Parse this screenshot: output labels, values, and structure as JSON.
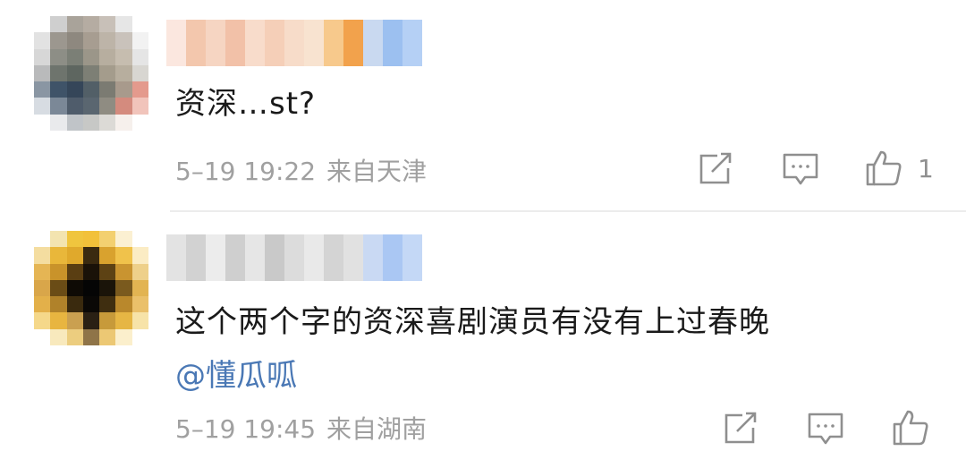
{
  "comments": [
    {
      "text": "资深…st?",
      "date": "5–19 19:22",
      "location": "来自天津",
      "like_count": "1"
    },
    {
      "text": "这个两个字的资深喜剧演员有没有上过春晚",
      "mention": "@懂瓜呱",
      "date": "5–19 19:45",
      "location": "来自湖南",
      "like_count": ""
    }
  ],
  "icons": {
    "share": "share-icon",
    "comment": "comment-icon",
    "like": "thumbs-up-icon"
  },
  "colors": {
    "text": "#1a1a1a",
    "meta": "#a0a0a0",
    "mention": "#4a78b5",
    "divider": "#ececec"
  },
  "avatars": [
    [
      "#ffffff",
      "#cfcfcf",
      "#a9a39a",
      "#b5aca2",
      "#c8c0b8",
      "#e6e6e6",
      "#ffffff",
      "#e2e2e2",
      "#9c978f",
      "#8e887f",
      "#a79d91",
      "#bdb4a8",
      "#c9c2bb",
      "#f2f2f2",
      "#d7d7d7",
      "#8d8e86",
      "#7b7f76",
      "#9b9689",
      "#b7ae9f",
      "#c6bdaf",
      "#e5e5e5",
      "#b9babb",
      "#6e746d",
      "#5e6660",
      "#7d7f75",
      "#a49c8c",
      "#b7ae9e",
      "#d8d6d1",
      "#8a96a3",
      "#3f5368",
      "#354659",
      "#525f67",
      "#7b7b72",
      "#a89a8c",
      "#e49a8d",
      "#d7dce2",
      "#7b8897",
      "#4f5c6b",
      "#5a6670",
      "#8f8c82",
      "#d48b7e",
      "#f1c4bb",
      "#ffffff",
      "#e9eaec",
      "#c0c4c8",
      "#c7c8c6",
      "#dcdad6",
      "#f6f0ec",
      "#ffffff"
    ],
    [
      "#ffffff",
      "#f3e4b0",
      "#f0c53e",
      "#f2c13a",
      "#f3d070",
      "#fbf0d2",
      "#ffffff",
      "#f4dda0",
      "#e9b73a",
      "#e0a92c",
      "#3a2a10",
      "#d9a22e",
      "#f0c24b",
      "#fbecc4",
      "#e5b554",
      "#c9932a",
      "#5a3e12",
      "#1a1208",
      "#5d4214",
      "#c99430",
      "#eed08a",
      "#d9a64a",
      "#6a4c16",
      "#0e0a05",
      "#050505",
      "#1a1409",
      "#7a5a1e",
      "#e2b452",
      "#e3b04a",
      "#b0822a",
      "#3a2a0e",
      "#0a0806",
      "#3f2e10",
      "#b9882c",
      "#eac06a",
      "#f5d88a",
      "#e8b540",
      "#caa050",
      "#2a2014",
      "#c79a3a",
      "#e6b644",
      "#f7e3a8",
      "#ffffff",
      "#f8e9bd",
      "#eccd7f",
      "#8f7448",
      "#ecc874",
      "#fbefcc",
      "#ffffff"
    ]
  ],
  "usernames": [
    [
      "#fbe7df",
      "#f3c7ad",
      "#f6d5c2",
      "#f2c1a8",
      "#f8dccb",
      "#f5cfb8",
      "#f7dcc9",
      "#f8e3d0",
      "#f7c98c",
      "#f2a24c",
      "#c9d9f0",
      "#9cc0f0",
      "#b5d0f5"
    ],
    [
      "#e3e3e3",
      "#d2d2d2",
      "#ececec",
      "#cfcfcf",
      "#e6e6e6",
      "#c9c9c9",
      "#dcdcdc",
      "#e9e9e9",
      "#d4d4d4",
      "#e1e1e1",
      "#c9d9f3",
      "#aac7f3",
      "#c4d8f6"
    ]
  ]
}
